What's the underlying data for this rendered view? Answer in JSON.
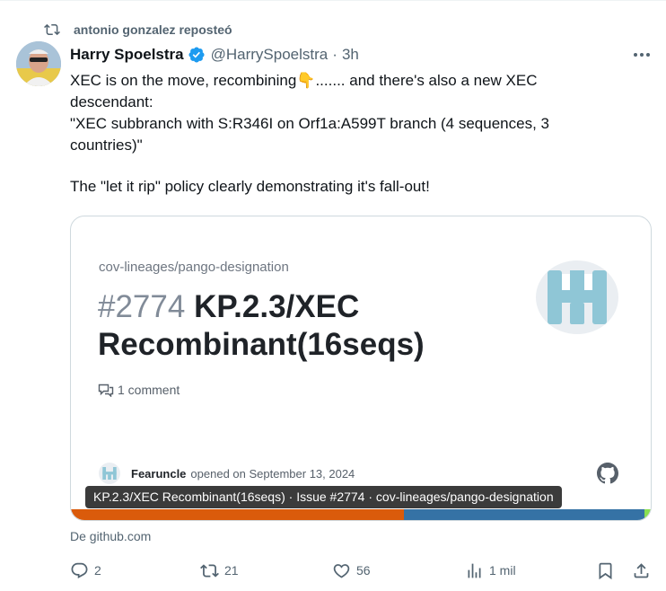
{
  "repost_header": {
    "text": "antonio gonzalez reposteó",
    "icon": "repost-icon"
  },
  "author": {
    "name": "Harry Spoelstra",
    "verified": true,
    "handle": "@HarrySpoelstra",
    "separator": "·",
    "time": "3h",
    "avatar": "avatar"
  },
  "tweet": {
    "line1": "XEC is on the move, recombining👇.......  and there's also a new XEC",
    "line2": "descendant:",
    "line3": "\"XEC subbranch with S:R346I on Orf1a:A599T branch (4 sequences, 3",
    "line4": "countries)\"",
    "line5": "The \"let it rip\" policy clearly demonstrating it's fall-out!"
  },
  "card": {
    "repo": "cov-lineages/pango-designation",
    "issue_number": "#2774",
    "issue_title": "KP.2.3/XEC Recombinant(16seqs)",
    "comments": "1 comment",
    "author": "Fearuncle",
    "opened": "opened on September 13, 2024",
    "overlay_title": "KP.2.3/XEC Recombinant(16seqs) · Issue #2774 · cov-lineages/pango-designation",
    "lang_colors": [
      "#da5b0b",
      "#3572a5",
      "#89e051"
    ]
  },
  "source": "De github.com",
  "actions": {
    "replies": "2",
    "reposts": "21",
    "likes": "56",
    "views": "1 mil"
  },
  "colors": {
    "verified": "#1d9bf0",
    "muted": "#536471",
    "text": "#0f1419"
  }
}
